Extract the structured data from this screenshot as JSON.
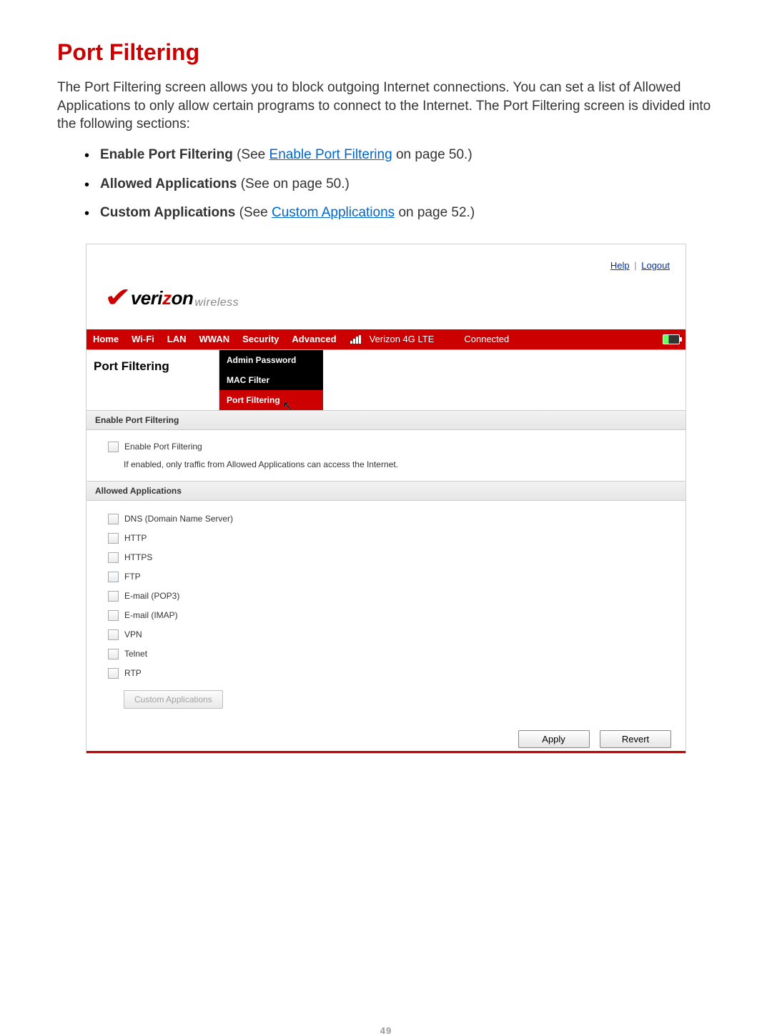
{
  "doc": {
    "title": "Port Filtering",
    "intro": "The Port Filtering screen allows you to block outgoing Internet connections. You can set a list of Allowed Applications to only allow certain programs to connect to the Internet. The Port Filtering screen is divided into the following sections:",
    "toc": [
      {
        "bold": "Enable Port Filtering",
        "pre": " (See ",
        "link": "Enable Port Filtering",
        "post": " on page 50.)"
      },
      {
        "bold": "Allowed Applications",
        "pre": " (See  on page 50.)",
        "link": "",
        "post": ""
      },
      {
        "bold": "Custom Applications",
        "pre": " (See ",
        "link": "Custom Applications",
        "post": " on page 52.)"
      }
    ],
    "page_number": "49"
  },
  "ui": {
    "top_links": {
      "help": "Help",
      "logout": "Logout",
      "sep": " | "
    },
    "logo": {
      "veri": "veri",
      "z": "z",
      "on": "on",
      "wireless": "wireless"
    },
    "nav": {
      "items": [
        "Home",
        "Wi-Fi",
        "LAN",
        "WWAN",
        "Security",
        "Advanced"
      ],
      "network": "Verizon  4G LTE",
      "status": "Connected"
    },
    "page_title": "Port Filtering",
    "submenu": [
      "Admin Password",
      "MAC Filter",
      "Port Filtering"
    ],
    "submenu_active_index": 2,
    "sections": {
      "enable": {
        "header": "Enable Port Filtering",
        "checkbox_label": "Enable Port Filtering",
        "hint": "If enabled, only traffic from Allowed Applications can access the Internet."
      },
      "allowed": {
        "header": "Allowed Applications",
        "apps": [
          "DNS (Domain Name Server)",
          "HTTP",
          "HTTPS",
          "FTP",
          "E-mail (POP3)",
          "E-mail (IMAP)",
          "VPN",
          "Telnet",
          "RTP"
        ],
        "custom_button": "Custom Applications"
      }
    },
    "buttons": {
      "apply": "Apply",
      "revert": "Revert"
    }
  }
}
